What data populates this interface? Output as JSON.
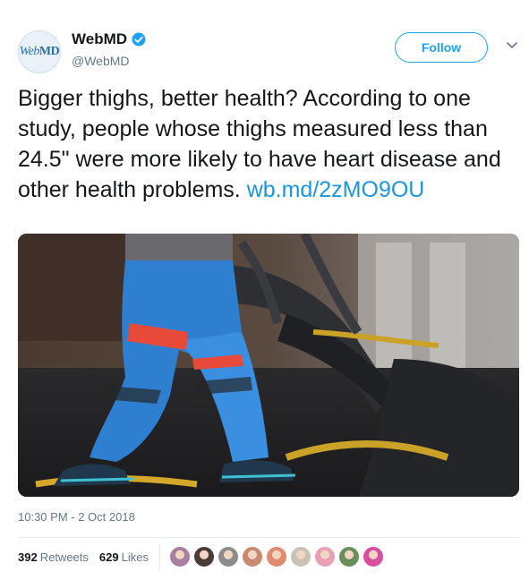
{
  "author": {
    "display_name": "WebMD",
    "handle": "@WebMD",
    "verified": true,
    "avatar_logo_web": "Web",
    "avatar_logo_md": "MD"
  },
  "follow_button": {
    "label": "Follow"
  },
  "tweet": {
    "text": "Bigger thighs, better health? According to one study, people whose thighs measured less than 24.5\" were more likely to have heart disease and other health problems. ",
    "link_text": "wb.md/2zMO9OU"
  },
  "timestamp": "10:30 PM - 2 Oct 2018",
  "stats": {
    "retweets_count": "392",
    "retweets_label": "Retweets",
    "likes_count": "629",
    "likes_label": "Likes"
  },
  "likers": [
    {
      "color": "#a87ea1"
    },
    {
      "color": "#4a3b36"
    },
    {
      "color": "#8c8c8c"
    },
    {
      "color": "#c98a72"
    },
    {
      "color": "#e08a6e"
    },
    {
      "color": "#c9c2b5"
    },
    {
      "color": "#e8a0b4"
    },
    {
      "color": "#6b8f5a"
    },
    {
      "color": "#d94fa0"
    }
  ],
  "colors": {
    "accent": "#1da1f2",
    "link": "#1b95e0",
    "secondary_text": "#657786"
  }
}
